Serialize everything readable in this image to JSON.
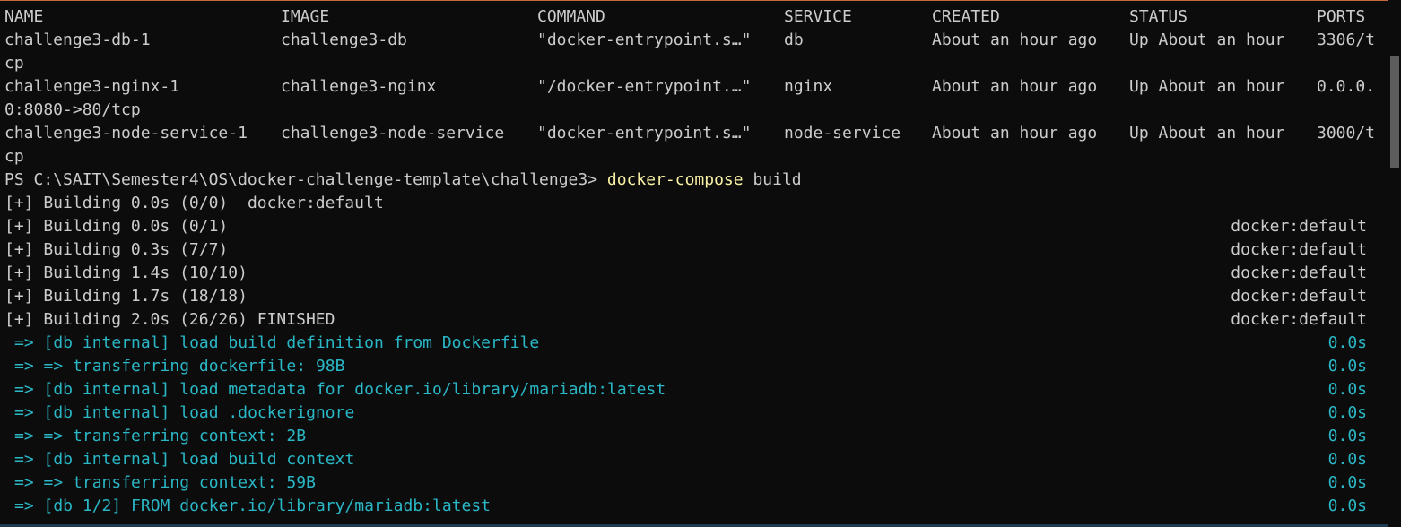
{
  "table": {
    "headers": {
      "name": "NAME",
      "image": "IMAGE",
      "command": "COMMAND",
      "service": "SERVICE",
      "created": "CREATED",
      "status": "STATUS",
      "ports": "PORTS"
    },
    "rows": [
      {
        "name": "challenge3-db-1",
        "image": "challenge3-db",
        "command": "\"docker-entrypoint.s…\"",
        "service": "db",
        "created": "About an hour ago",
        "status": "Up About an hour",
        "ports": "3306/t",
        "ports_wrap": "cp"
      },
      {
        "name": "challenge3-nginx-1",
        "image": "challenge3-nginx",
        "command": "\"/docker-entrypoint.…\"",
        "service": "nginx",
        "created": "About an hour ago",
        "status": "Up About an hour",
        "ports": "0.0.0.",
        "ports_wrap": "0:8080->80/tcp"
      },
      {
        "name": "challenge3-node-service-1",
        "image": "challenge3-node-service",
        "command": "\"docker-entrypoint.s…\"",
        "service": "node-service",
        "created": "About an hour ago",
        "status": "Up About an hour",
        "ports": "3000/t",
        "ports_wrap": "cp"
      }
    ]
  },
  "prompt": {
    "path": "PS C:\\SAIT\\Semester4\\OS\\docker-challenge-template\\challenge3> ",
    "command": "docker-compose",
    "args": " build"
  },
  "build": {
    "first": {
      "text": "[+] Building 0.0s (0/0)",
      "target": "docker:default"
    },
    "lines": [
      {
        "text": "[+] Building 0.0s (0/1)",
        "target": "docker:default"
      },
      {
        "text": "[+] Building 0.3s (7/7)",
        "target": "docker:default"
      },
      {
        "text": "[+] Building 1.4s (10/10)",
        "target": "docker:default"
      },
      {
        "text": "[+] Building 1.7s (18/18)",
        "target": "docker:default"
      },
      {
        "text": "[+] Building 2.0s (26/26) FINISHED",
        "target": "docker:default"
      }
    ],
    "steps": [
      {
        "text": "=> [db internal] load build definition from Dockerfile",
        "time": "0.0s"
      },
      {
        "text": "=> => transferring dockerfile: 98B",
        "time": "0.0s"
      },
      {
        "text": "=> [db internal] load metadata for docker.io/library/mariadb:latest",
        "time": "0.0s"
      },
      {
        "text": "=> [db internal] load .dockerignore",
        "time": "0.0s"
      },
      {
        "text": "=> => transferring context: 2B",
        "time": "0.0s"
      },
      {
        "text": "=> [db internal] load build context",
        "time": "0.0s"
      },
      {
        "text": "=> => transferring context: 59B",
        "time": "0.0s"
      },
      {
        "text": "=> [db 1/2] FROM docker.io/library/mariadb:latest",
        "time": "0.0s"
      }
    ]
  },
  "colors": {
    "background": "#0c0c0c",
    "text": "#cccccc",
    "command_highlight": "#f9f1a5",
    "step_text": "#2ab7c6"
  }
}
